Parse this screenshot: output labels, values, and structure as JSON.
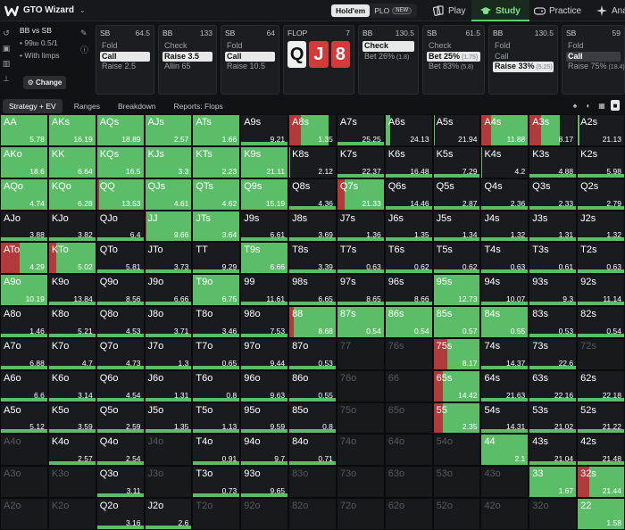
{
  "app": {
    "title": "GTO Wizard"
  },
  "game_toggle": {
    "holdem": "Hold'em",
    "plo": "PLO",
    "new_badge": "NEW"
  },
  "nav": {
    "play": "Play",
    "study": "Study",
    "practice": "Practice",
    "analyze": "Ana"
  },
  "spot": {
    "positions": "BB vs SB",
    "stakes_prefix": "99",
    "stakes_unit": "bb",
    "stakes": "0.5/1",
    "option": "With limps",
    "change": "Change"
  },
  "panels": [
    {
      "pos": "SB",
      "stack": "64.5",
      "actions": [
        {
          "t": "Fold"
        },
        {
          "t": "Call",
          "sel": true
        },
        {
          "t": "Raise 2.5"
        }
      ]
    },
    {
      "pos": "BB",
      "stack": "133",
      "actions": [
        {
          "t": "Check"
        },
        {
          "t": "Raise 3.5",
          "sel": true
        },
        {
          "t": "Allin 65"
        }
      ]
    },
    {
      "pos": "SB",
      "stack": "64",
      "actions": [
        {
          "t": "Fold"
        },
        {
          "t": "Call",
          "sel": true
        },
        {
          "t": "Raise 10.5"
        }
      ]
    },
    {
      "pos": "FLOP",
      "stack": "7",
      "cards": [
        "Q",
        "J",
        "8"
      ]
    },
    {
      "pos": "BB",
      "stack": "130.5",
      "actions": [
        {
          "t": "Check",
          "sel": true
        },
        {
          "t": "Bet 26%",
          "p": "(1.8)"
        }
      ]
    },
    {
      "pos": "SB",
      "stack": "61.5",
      "actions": [
        {
          "t": "Check"
        },
        {
          "t": "Bet 25%",
          "p": "(1.75)",
          "sel": true
        },
        {
          "t": "Bet 83%",
          "p": "(5.8)"
        }
      ]
    },
    {
      "pos": "BB",
      "stack": "130.5",
      "actions": [
        {
          "t": "Fold"
        },
        {
          "t": "Call"
        },
        {
          "t": "Raise 33%",
          "p": "(5.25)",
          "sel": true
        }
      ]
    },
    {
      "pos": "SB",
      "stack": "59",
      "actions": [
        {
          "t": "Fold"
        },
        {
          "t": "Call",
          "sel": true
        },
        {
          "t": "Raise 75%",
          "p": "(18.4)"
        }
      ]
    }
  ],
  "tabs": {
    "strategy": "Strategy + EV",
    "ranges": "Ranges",
    "breakdown": "Breakdown",
    "reports": "Reports: Flops"
  },
  "colors": {
    "call": "#5cbd68",
    "raise": "#b23a3a",
    "fold": "#1d4f8a"
  },
  "grid": [
    [
      "AA|5.78|0|100",
      "AKs|16.19|0|100",
      "AQs|18.89|0|100",
      "AJs|2.57|0|100",
      "ATs|1.66|0|100",
      "A9s|9.21|0|0",
      "A8s|1.35|25|60",
      "A7s|25.25|0|0",
      "A6s|24.13|0|10",
      "A5s|21.94|0|3",
      "A4s|11.88|20|80",
      "A3s|8.17|25|40",
      "A2s|21.13|0|3"
    ],
    [
      "AKo|18.6|0|100",
      "KK|6.64|0|100",
      "KQs|16.5|0|100",
      "KJs|3.3|0|100",
      "KTs|2.23|0|100",
      "K9s|21.11|0|100",
      "K8s|2.12|0|2",
      "K7s|22.37|0|0",
      "K6s|16.48|0|0",
      "K5s|7.29|0|0",
      "K4s|4.2|0|2",
      "K3s|4.88|0|0",
      "K2s|5.98|0|0"
    ],
    [
      "AQo|4.74|0|100",
      "KQo|6.28|0|100",
      "QQ|13.53|5|95",
      "QJs|4.61|0|100",
      "QTs|4.62|0|100",
      "Q9s|15.19|0|100",
      "Q8s|4.36|0|0",
      "Q7s|21.33|15|85",
      "Q6s|14.46|0|0",
      "Q5s|2.87|0|0",
      "Q4s|2.36|0|0",
      "Q3s|2.33|0|0",
      "Q2s|2.79|0|0"
    ],
    [
      "AJo|3.88|0|0",
      "KJo|3.82|0|0",
      "QJo|6.4|0|0",
      "JJ|9.66|3|97",
      "JTs|3.64|0|100",
      "J9s|6.61|0|0",
      "J8s|3.69|0|0",
      "J7s|1.36|0|0",
      "J6s|1.35|0|0",
      "J5s|1.34|0|0",
      "J4s|1.32|0|0",
      "J3s|1.31|0|0",
      "J2s|1.32|0|0"
    ],
    [
      "ATo|4.29|40|60",
      "KTo|5.02|15|85",
      "QTo|5.81|0|0",
      "JTo|3.73|0|0",
      "TT|9.29|0|0",
      "T9s|6.66|0|100",
      "T8s|3.39|0|0",
      "T7s|0.63|0|0",
      "T6s|0.62|0|0",
      "T5s|0.62|0|0",
      "T4s|0.63|0|0",
      "T3s|0.61|0|0",
      "T2s|0.63|0|0"
    ],
    [
      "A9o|10.19|0|100",
      "K9o|13.84|0|0",
      "Q9o|8.56|0|0",
      "J9o|6.66|0|0",
      "T9o|6.75|0|100",
      "99|11.61|0|0",
      "98s|6.65|0|0",
      "97s|8.65|0|0",
      "96s|8.66|0|0",
      "95s|12.73|0|100",
      "94s|10.07|0|0",
      "93s|9.3|0|0",
      "92s|11.14|0|0"
    ],
    [
      "A8o|1.46|0|0",
      "K8o|5.21|0|0",
      "Q8o|4.53|0|0",
      "J8o|3.71|0|0",
      "T8o|3.46|0|0",
      "98o|7.53|0|0",
      "88|8.68|10|90",
      "87s|0.54|0|100",
      "86s|0.54|0|100",
      "85s|0.57|0|100",
      "84s|0.55|0|100",
      "83s|0.53|0|0",
      "82s|0.54|0|0"
    ],
    [
      "A7o|6.88|0|0",
      "K7o|4.7|0|0",
      "Q7o|4.73|0|0",
      "J7o|1.3|0|0",
      "T7o|0.65|0|0",
      "97o|9.44|0|0",
      "87o|0.53|0|0",
      "77||0|0",
      "76s||0|0",
      "75s|8.17|30|70",
      "74s|14.37|0|0",
      "73s|22.6|0|0",
      "72s||0|0"
    ],
    [
      "A6o|6.6|0|0",
      "K6o|3.14|0|0",
      "Q6o|4.54|0|0",
      "J6o|1.31|0|0",
      "T6o|0.8|0|0",
      "96o|9.63|0|0",
      "86o|0.55|0|0",
      "76o||0|0",
      "66||0|0",
      "65s|14.42|20|80",
      "64s|21.63|0|0",
      "63s|22.16|0|0",
      "62s|22.18|0|0"
    ],
    [
      "A5o|5.12|0|0",
      "K5o|3.59|0|0",
      "Q5o|2.59|0|0",
      "J5o|1.35|0|0",
      "T5o|1.13|0|0",
      "95o|9.59|0|0",
      "85o|0.8|0|0",
      "75o||0|0",
      "65o||0|0",
      "55|2.35|20|80",
      "54s|14.31|0|0",
      "53s|21.02|0|0",
      "52s|21.22|0|0"
    ],
    [
      "A4o||0|0",
      "K4o|2.57|0|0",
      "Q4o|2.54|0|0",
      "J4o||0|0",
      "T4o|0.91|0|0",
      "94o|9.7|0|0",
      "84o|0.71|0|0",
      "74o||0|0",
      "64o||0|0",
      "54o||0|0",
      "44|2.1|0|100",
      "43s|21.04|0|0",
      "42s|21.48|0|0"
    ],
    [
      "A3o||0|0",
      "K3o||0|0",
      "Q3o|3.11|0|0",
      "J3o||0|0",
      "T3o|0.73|0|0",
      "93o|9.65|0|0",
      "83o||0|0",
      "73o||0|0",
      "63o||0|0",
      "53o||0|0",
      "43o||0|0",
      "33|1.67|0|100",
      "32s|21.44|25|75"
    ],
    [
      "A2o||0|0",
      "K2o||0|0",
      "Q2o|3.16|0|0",
      "J2o|2.6|0|0",
      "T2o||0|0",
      "92o||0|0",
      "82o||0|0",
      "72o||0|0",
      "62o||0|0",
      "52o||0|0",
      "42o||0|0",
      "32o||0|0",
      "22|1.58|0|100"
    ]
  ]
}
